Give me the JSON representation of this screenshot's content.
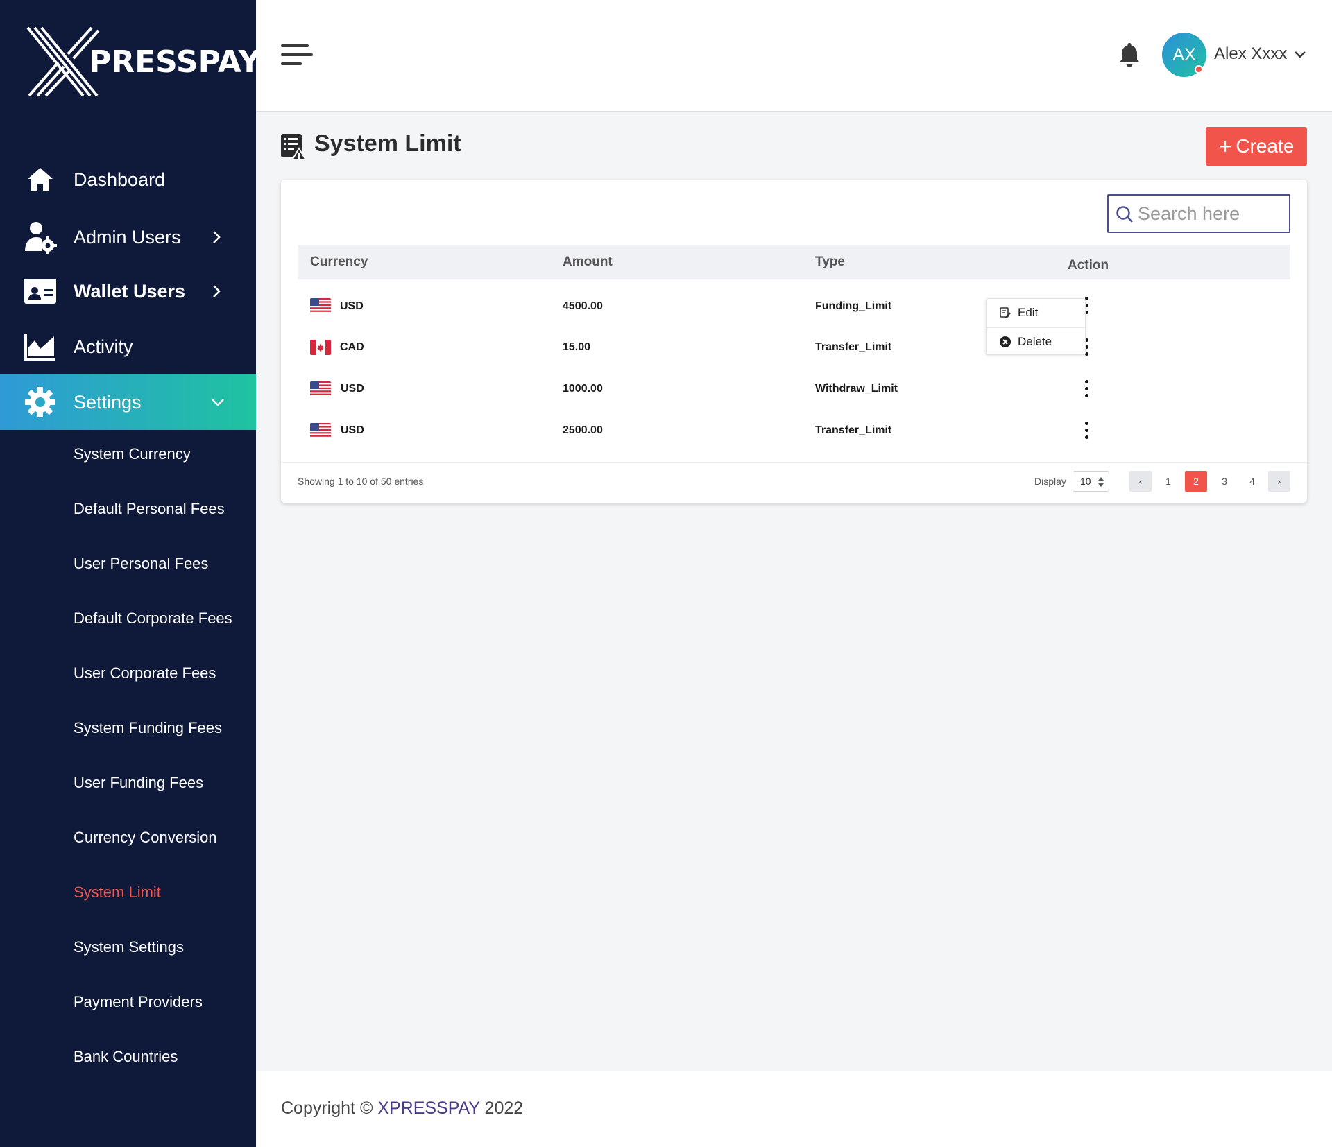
{
  "brand": {
    "logo_text": "PRESSPAY"
  },
  "sidebar": {
    "nav": [
      {
        "label": "Dashboard",
        "icon": "home-icon"
      },
      {
        "label": "Admin Users",
        "icon": "user-gear-icon"
      },
      {
        "label": "Wallet Users",
        "icon": "id-card-icon"
      },
      {
        "label": "Activity",
        "icon": "area-chart-icon"
      },
      {
        "label": "Settings",
        "icon": "gear-icon"
      }
    ],
    "settings_items": [
      "System Currency",
      "Default Personal Fees",
      "User Personal Fees",
      "Default Corporate Fees",
      "User Corporate Fees",
      "System Funding Fees",
      "User Funding Fees",
      "Currency Conversion",
      "System Limit",
      "System Settings",
      "Payment Providers",
      "Bank Countries"
    ],
    "current_item": "System Limit",
    "colors": {
      "background": "#0f1a3b",
      "active_start": "#2f9ad6",
      "active_end": "#1fc3a0",
      "current": "#f0544a"
    }
  },
  "topbar": {
    "user_initials": "AX",
    "user_name": "Alex Xxxx"
  },
  "page": {
    "title": "System Limit",
    "create_label": "Create",
    "create_plus": "+",
    "accent": "#f0544a"
  },
  "search": {
    "placeholder": "Search here",
    "value": ""
  },
  "table": {
    "headers": [
      "Currency",
      "Amount",
      "Type",
      "Action"
    ],
    "rows": [
      {
        "flag": "us-flag",
        "currency": "USD",
        "amount": "4500.00",
        "type": "Funding_Limit"
      },
      {
        "flag": "ca-flag",
        "currency": "CAD",
        "amount": "15.00",
        "type": "Transfer_Limit"
      },
      {
        "flag": "us-flag",
        "currency": "USD",
        "amount": "1000.00",
        "type": "Withdraw_Limit"
      },
      {
        "flag": "us-flag",
        "currency": "USD",
        "amount": "2500.00",
        "type": "Transfer_Limit"
      }
    ],
    "row_menu": {
      "edit_label": "Edit",
      "delete_label": "Delete"
    }
  },
  "pagination": {
    "entries_text": "Showing 1 to 10 of 50 entries",
    "display_label": "Display",
    "display_value": "10",
    "pages": [
      "1",
      "2",
      "3",
      "4"
    ],
    "current_page": "2",
    "prev": "‹",
    "next": "›"
  },
  "footer": {
    "prefix": "Copyright © ",
    "brand": "XPRESSPAY",
    "year": " 2022"
  }
}
